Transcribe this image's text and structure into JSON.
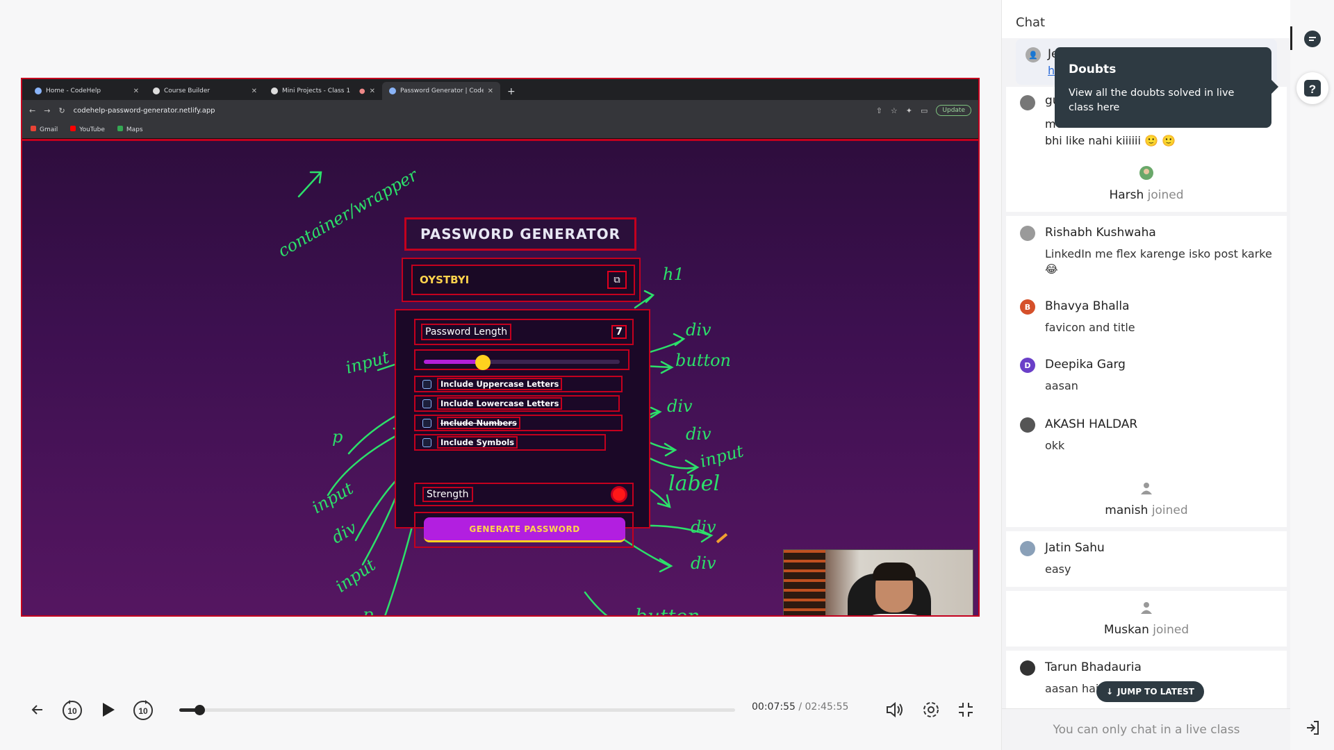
{
  "browser": {
    "tabs": [
      {
        "label": "Home - CodeHelp"
      },
      {
        "label": "Course Builder"
      },
      {
        "label": "Mini Projects - Class 1"
      },
      {
        "label": "Password Generator | CodeHe"
      }
    ],
    "url": "codehelp-password-generator.netlify.app",
    "update_label": "Update",
    "bookmarks": [
      "Gmail",
      "YouTube",
      "Maps"
    ]
  },
  "app": {
    "title": "PASSWORD GENERATOR",
    "password": "OYSTBYI",
    "length_label": "Password Length",
    "length_value": "7",
    "slider_fraction": 0.3,
    "options": [
      "Include Uppercase Letters",
      "Include Lowercase Letters",
      "Include Numbers",
      "Include Symbols"
    ],
    "strength_label": "Strength",
    "generate_label": "GENERATE PASSWORD"
  },
  "annotations": {
    "container": "container/wrapper",
    "h1": "h1",
    "div1": "div",
    "button1": "button",
    "input1": "input",
    "div2": "div",
    "div3": "div",
    "p1": "p",
    "input2": "input",
    "label": "label",
    "input3": "input",
    "div4": "div",
    "div5": "div",
    "input4": "input",
    "div6": "div",
    "p2": "p",
    "button2": "button"
  },
  "player": {
    "current_time": "00:07:55",
    "separator": "/",
    "total_time": "02:45:55",
    "progress_fraction": 0.036
  },
  "chat": {
    "title": "Chat",
    "first_partial_name": "Je",
    "first_partial_link": "h",
    "partial_name": "gu",
    "partial_line": "me",
    "partial_text": "bhi like nahi kiiiiii 🙂 🙂",
    "joined_word": "joined",
    "events": [
      {
        "type": "join",
        "name": "Harsh"
      },
      {
        "type": "msg",
        "name": "Rishabh Kushwaha",
        "text": "LinkedIn me flex karenge isko post karke 😂"
      },
      {
        "type": "msg",
        "name": "Bhavya Bhalla",
        "text": "favicon and title",
        "initial": "B"
      },
      {
        "type": "msg",
        "name": "Deepika Garg",
        "text": "aasan",
        "initial": "D"
      },
      {
        "type": "msg",
        "name": "AKASH HALDAR",
        "text": "okk"
      },
      {
        "type": "join",
        "name": "manish"
      },
      {
        "type": "msg",
        "name": "Jatin Sahu",
        "text": "easy"
      },
      {
        "type": "join",
        "name": "Muskan"
      },
      {
        "type": "msg",
        "name": "Tarun Bhadauria",
        "text": "aasan hai"
      }
    ],
    "jump_label": "JUMP TO LATEST",
    "footer": "You can only chat in a live class"
  },
  "tooltip": {
    "title": "Doubts",
    "text": "View all the doubts solved in live class here"
  },
  "colors": {
    "annotation": "#2ce06a",
    "outline": "#c4001e",
    "accent": "#b21fe0",
    "tooltip_bg": "#2e3a42"
  }
}
